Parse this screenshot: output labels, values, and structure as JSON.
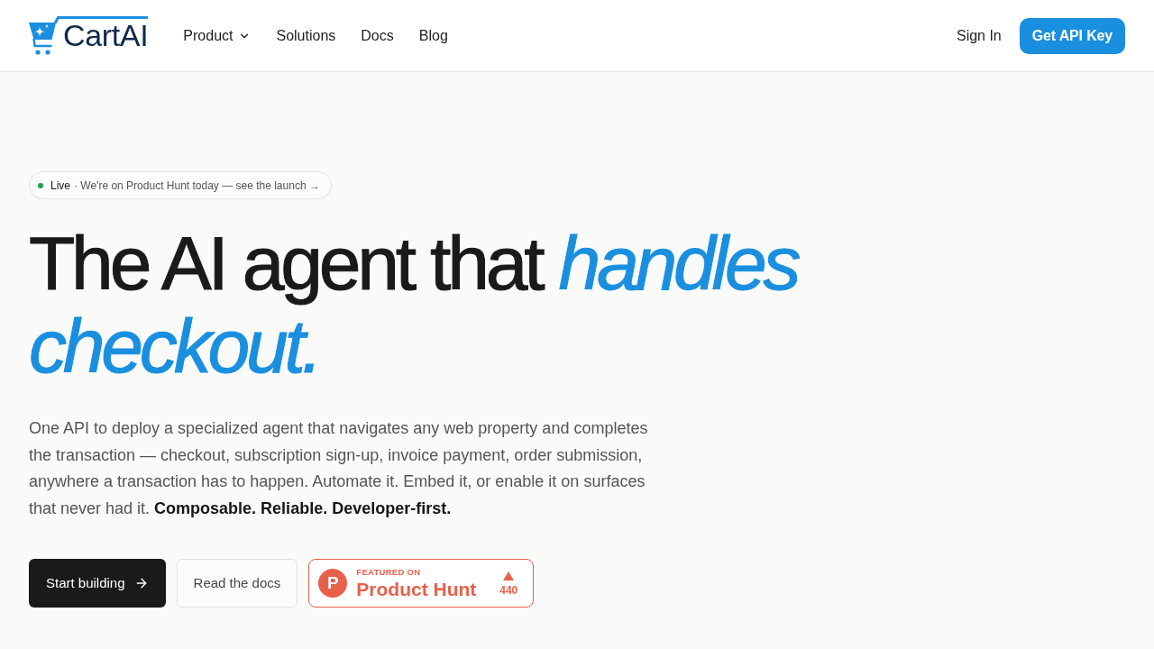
{
  "header": {
    "logo": "CartAI",
    "nav": [
      {
        "label": "Product",
        "dropdown": true
      },
      {
        "label": "Solutions",
        "dropdown": false
      },
      {
        "label": "Docs",
        "dropdown": false
      },
      {
        "label": "Blog",
        "dropdown": false
      }
    ],
    "sign_in": "Sign In",
    "cta": "Get API Key"
  },
  "hero": {
    "announcement": {
      "status": "Live",
      "message": "· We're on Product Hunt today — see the launch →"
    },
    "headline": "The AI agent that *handles checkout.*",
    "description": "One API to deploy a specialized agent that navigates any web property and completes the transaction — checkout, subscription sign-up, invoice payment, order submission, anywhere a transaction has to happen. Automate it. Embed it, or enable it on surfaces that never had it. **Composable. Reliable. Developer-first.**",
    "buttons": [
      {
        "kind": "primary",
        "label": "Start building"
      },
      {
        "kind": "secondary",
        "label": "Read the docs"
      }
    ],
    "product_hunt": {
      "logo_letter": "P",
      "eyebrow": "FEATURED ON",
      "name": "Product Hunt",
      "votes": "440"
    }
  }
}
